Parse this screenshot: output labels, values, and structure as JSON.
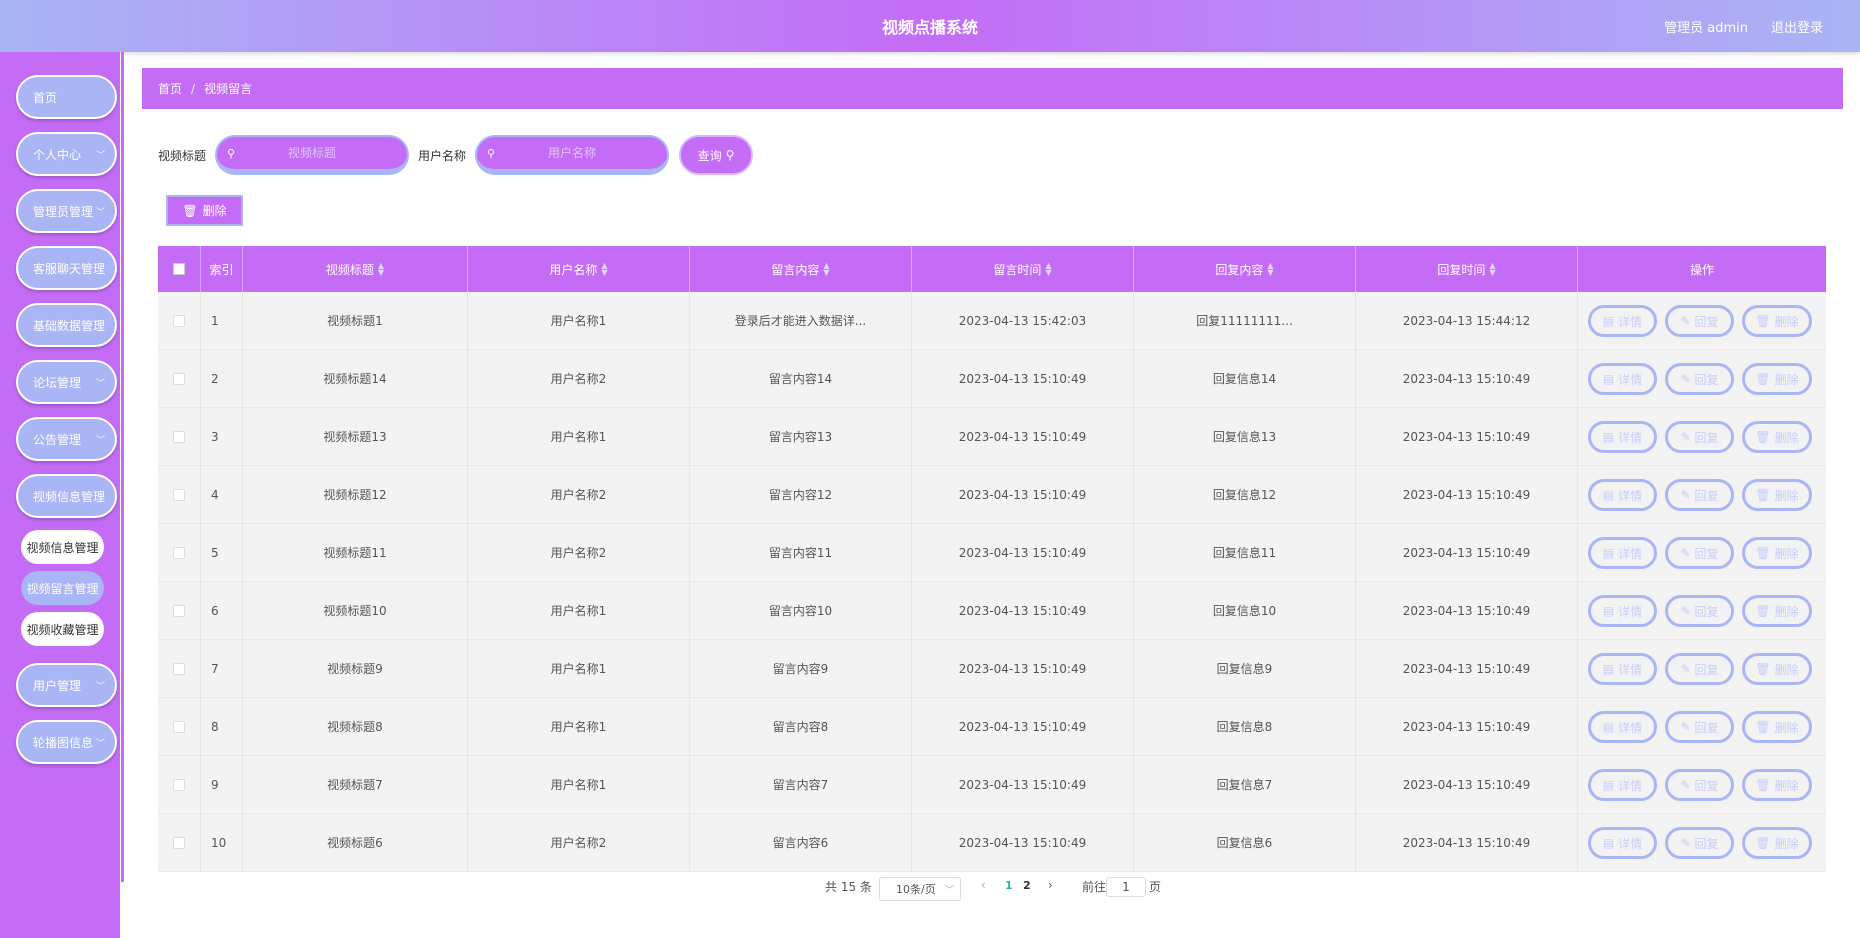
{
  "header": {
    "title": "视频点播系统",
    "user": "管理员 admin",
    "logout": "退出登录"
  },
  "sidebar": {
    "items": [
      {
        "label": "首页",
        "chevron": false
      },
      {
        "label": "个人中心",
        "chevron": true
      },
      {
        "label": "管理员管理",
        "chevron": true
      },
      {
        "label": "客服聊天管理",
        "chevron": true
      },
      {
        "label": "基础数据管理",
        "chevron": true
      },
      {
        "label": "论坛管理",
        "chevron": true
      },
      {
        "label": "公告管理",
        "chevron": true
      },
      {
        "label": "视频信息管理",
        "chevron": true
      },
      {
        "label": "用户管理",
        "chevron": true
      },
      {
        "label": "轮播图信息",
        "chevron": true
      }
    ],
    "subitems": [
      {
        "label": "视频信息管理",
        "active": false
      },
      {
        "label": "视频留言管理",
        "active": true
      },
      {
        "label": "视频收藏管理",
        "active": false
      }
    ]
  },
  "breadcrumb": {
    "home": "首页",
    "sep": "/",
    "current": "视频留言"
  },
  "search": {
    "title_label": "视频标题",
    "title_placeholder": "视频标题",
    "user_label": "用户名称",
    "user_placeholder": "用户名称",
    "query_label": "查询"
  },
  "toolbar": {
    "delete_label": "删除"
  },
  "table": {
    "columns": [
      "索引",
      "视频标题",
      "用户名称",
      "留言内容",
      "留言时间",
      "回复内容",
      "回复时间",
      "操作"
    ],
    "actions": {
      "detail": "详情",
      "reply": "回复",
      "delete": "删除"
    },
    "rows": [
      [
        "1",
        "视频标题1",
        "用户名称1",
        "登录后才能进入数据详...",
        "2023-04-13 15:42:03",
        "回复11111111...",
        "2023-04-13 15:44:12"
      ],
      [
        "2",
        "视频标题14",
        "用户名称2",
        "留言内容14",
        "2023-04-13 15:10:49",
        "回复信息14",
        "2023-04-13 15:10:49"
      ],
      [
        "3",
        "视频标题13",
        "用户名称1",
        "留言内容13",
        "2023-04-13 15:10:49",
        "回复信息13",
        "2023-04-13 15:10:49"
      ],
      [
        "4",
        "视频标题12",
        "用户名称2",
        "留言内容12",
        "2023-04-13 15:10:49",
        "回复信息12",
        "2023-04-13 15:10:49"
      ],
      [
        "5",
        "视频标题11",
        "用户名称2",
        "留言内容11",
        "2023-04-13 15:10:49",
        "回复信息11",
        "2023-04-13 15:10:49"
      ],
      [
        "6",
        "视频标题10",
        "用户名称1",
        "留言内容10",
        "2023-04-13 15:10:49",
        "回复信息10",
        "2023-04-13 15:10:49"
      ],
      [
        "7",
        "视频标题9",
        "用户名称1",
        "留言内容9",
        "2023-04-13 15:10:49",
        "回复信息9",
        "2023-04-13 15:10:49"
      ],
      [
        "8",
        "视频标题8",
        "用户名称1",
        "留言内容8",
        "2023-04-13 15:10:49",
        "回复信息8",
        "2023-04-13 15:10:49"
      ],
      [
        "9",
        "视频标题7",
        "用户名称1",
        "留言内容7",
        "2023-04-13 15:10:49",
        "回复信息7",
        "2023-04-13 15:10:49"
      ],
      [
        "10",
        "视频标题6",
        "用户名称2",
        "留言内容6",
        "2023-04-13 15:10:49",
        "回复信息6",
        "2023-04-13 15:10:49"
      ]
    ]
  },
  "pagination": {
    "total_text": "共 15 条",
    "page_size": "10条/页",
    "pages": [
      "1",
      "2"
    ],
    "current_page": "1",
    "goto_prefix": "前往",
    "goto_value": "1",
    "goto_suffix": "页"
  },
  "colors": {
    "primary": "#c46cf6",
    "secondary": "#a9b5f5",
    "active_page": "#2bb5a0"
  }
}
